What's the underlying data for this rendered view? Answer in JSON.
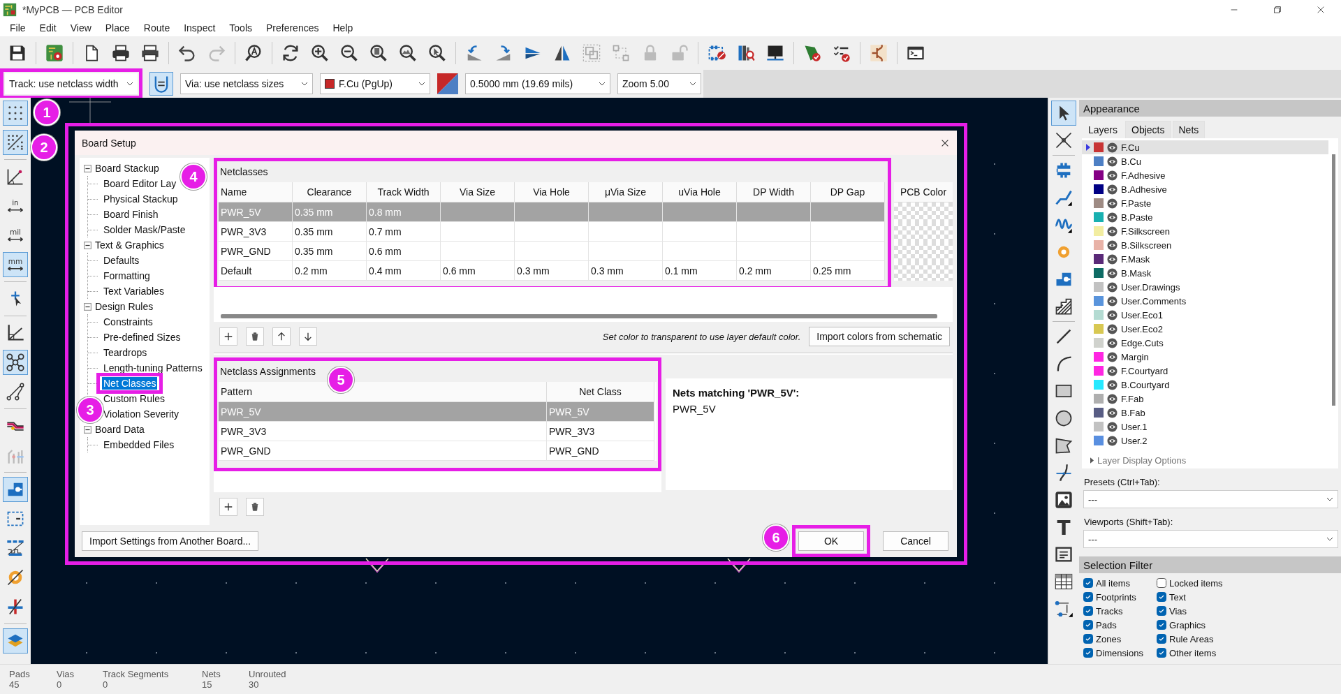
{
  "window": {
    "title": "*MyPCB — PCB Editor"
  },
  "menu": [
    "File",
    "Edit",
    "View",
    "Place",
    "Route",
    "Inspect",
    "Tools",
    "Preferences",
    "Help"
  ],
  "toolbar2": {
    "track": "Track: use netclass width",
    "width_toggle": {
      "selected": true
    },
    "via": "Via: use netclass sizes",
    "layer": "F.Cu (PgUp)",
    "grid": "0.5000 mm (19.69 mils)",
    "zoom": "Zoom 5.00"
  },
  "left_toolbar": [
    {
      "selected": true
    },
    {
      "selected": true
    },
    {
      "selected": false
    },
    {
      "label": "in",
      "selected": false
    },
    {
      "label": "mil",
      "selected": false
    },
    {
      "label": "mm",
      "selected": true
    },
    {
      "selected": false
    },
    {
      "selected": false
    },
    {
      "selected": true
    },
    {
      "selected": false
    },
    {
      "selected": false
    },
    {
      "selected": false
    },
    {
      "selected": true
    },
    {
      "selected": false
    },
    {
      "selected": false
    },
    {
      "selected": false
    },
    {
      "selected": false
    },
    {
      "selected": true
    }
  ],
  "dialog": {
    "title": "Board Setup",
    "tree": [
      {
        "label": "Board Stackup",
        "expanded": true,
        "selected": false,
        "children": [
          {
            "label": "Board Editor Lay",
            "selected": false
          },
          {
            "label": "Physical Stackup",
            "selected": false
          },
          {
            "label": "Board Finish",
            "selected": false
          },
          {
            "label": "Solder Mask/Paste",
            "selected": false
          }
        ]
      },
      {
        "label": "Text & Graphics",
        "expanded": true,
        "selected": false,
        "children": [
          {
            "label": "Defaults",
            "selected": false
          },
          {
            "label": "Formatting",
            "selected": false
          },
          {
            "label": "Text Variables",
            "selected": false
          }
        ]
      },
      {
        "label": "Design Rules",
        "expanded": true,
        "selected": false,
        "children": [
          {
            "label": "Constraints",
            "selected": false
          },
          {
            "label": "Pre-defined Sizes",
            "selected": false
          },
          {
            "label": "Teardrops",
            "selected": false
          },
          {
            "label": "Length-tuning Patterns",
            "selected": false
          },
          {
            "label": "Net Classes",
            "selected": true
          },
          {
            "label": "Custom Rules",
            "selected": false
          },
          {
            "label": "Violation Severity",
            "selected": false
          }
        ]
      },
      {
        "label": "Board Data",
        "expanded": true,
        "selected": false,
        "children": [
          {
            "label": "Embedded Files",
            "selected": false
          }
        ]
      }
    ],
    "netclasses": {
      "title": "Netclasses",
      "columns": [
        "Name",
        "Clearance",
        "Track Width",
        "Via Size",
        "Via Hole",
        "μVia Size",
        "uVia Hole",
        "DP Width",
        "DP Gap"
      ],
      "color_column": "PCB Color",
      "rows": [
        {
          "selected": true,
          "cells": [
            "PWR_5V",
            "0.35 mm",
            "0.8 mm",
            null,
            null,
            null,
            null,
            null,
            null
          ]
        },
        {
          "selected": false,
          "cells": [
            "PWR_3V3",
            "0.35 mm",
            "0.7 mm",
            null,
            null,
            null,
            null,
            null,
            null
          ]
        },
        {
          "selected": false,
          "cells": [
            "PWR_GND",
            "0.35 mm",
            "0.6 mm",
            null,
            null,
            null,
            null,
            null,
            null
          ]
        },
        {
          "selected": false,
          "cells": [
            "Default",
            "0.2 mm",
            "0.4 mm",
            "0.6 mm",
            "0.3 mm",
            "0.3 mm",
            "0.1 mm",
            "0.2 mm",
            "0.25 mm"
          ]
        }
      ]
    },
    "note": "Set color to transparent to use layer default color.",
    "import_colors_button": "Import colors from schematic",
    "assignments": {
      "title": "Netclass Assignments",
      "columns": [
        "Pattern",
        "Net Class"
      ],
      "rows": [
        {
          "pattern": "PWR_5V",
          "net_class": "PWR_5V",
          "selected": true
        },
        {
          "pattern": "PWR_3V3",
          "net_class": "PWR_3V3",
          "selected": false
        },
        {
          "pattern": "PWR_GND",
          "net_class": "PWR_GND",
          "selected": false
        }
      ]
    },
    "matches": {
      "title": "Nets matching 'PWR_5V':",
      "nets": [
        "PWR_5V"
      ]
    },
    "import_settings_button": "Import Settings from Another Board...",
    "ok_button": "OK",
    "cancel_button": "Cancel"
  },
  "right_toolbar": [
    {
      "selected": true
    },
    {
      "selected": false
    },
    {
      "selected": false
    },
    {
      "selected": false
    },
    {
      "selected": false
    },
    {
      "selected": false
    },
    {
      "selected": false
    },
    {
      "selected": false
    },
    {
      "selected": false
    },
    {
      "selected": false
    },
    {
      "selected": false
    },
    {
      "selected": false
    },
    {
      "selected": false
    },
    {
      "selected": false
    },
    {
      "selected": false
    },
    {
      "label": "T",
      "selected": false
    },
    {
      "selected": false
    },
    {
      "selected": false
    },
    {
      "selected": false
    }
  ],
  "appearance": {
    "title": "Appearance",
    "tabs": [
      {
        "label": "Layers",
        "selected": true
      },
      {
        "label": "Objects",
        "selected": false
      },
      {
        "label": "Nets",
        "selected": false
      }
    ],
    "layers": [
      {
        "name": "F.Cu",
        "color": "#c83434",
        "selected": true
      },
      {
        "name": "B.Cu",
        "color": "#4d7fc4",
        "selected": false
      },
      {
        "name": "F.Adhesive",
        "color": "#840084",
        "selected": false
      },
      {
        "name": "B.Adhesive",
        "color": "#000084",
        "selected": false
      },
      {
        "name": "F.Paste",
        "color": "#9e8b84",
        "selected": false
      },
      {
        "name": "B.Paste",
        "color": "#18b0b0",
        "selected": false
      },
      {
        "name": "F.Silkscreen",
        "color": "#f2eda1",
        "selected": false
      },
      {
        "name": "B.Silkscreen",
        "color": "#e8b2a7",
        "selected": false
      },
      {
        "name": "F.Mask",
        "color": "#5a2a78",
        "selected": false
      },
      {
        "name": "B.Mask",
        "color": "#0e6b64",
        "selected": false
      },
      {
        "name": "User.Drawings",
        "color": "#c2c2c2",
        "selected": false
      },
      {
        "name": "User.Comments",
        "color": "#5994dc",
        "selected": false
      },
      {
        "name": "User.Eco1",
        "color": "#b4dbd2",
        "selected": false
      },
      {
        "name": "User.Eco2",
        "color": "#d8c852",
        "selected": false
      },
      {
        "name": "Edge.Cuts",
        "color": "#d0d2cd",
        "selected": false
      },
      {
        "name": "Margin",
        "color": "#ff26e2",
        "selected": false
      },
      {
        "name": "F.Courtyard",
        "color": "#ff26e2",
        "selected": false
      },
      {
        "name": "B.Courtyard",
        "color": "#26e9ff",
        "selected": false
      },
      {
        "name": "F.Fab",
        "color": "#afafaf",
        "selected": false
      },
      {
        "name": "B.Fab",
        "color": "#585d84",
        "selected": false
      },
      {
        "name": "User.1",
        "color": "#c2c2c2",
        "selected": false
      },
      {
        "name": "User.2",
        "color": "#598fe0",
        "selected": false
      }
    ],
    "layer_display_options": "Layer Display Options",
    "presets": {
      "label": "Presets (Ctrl+Tab):",
      "value": "---"
    },
    "viewports": {
      "label": "Viewports (Shift+Tab):",
      "value": "---"
    }
  },
  "selection_filter": {
    "title": "Selection Filter",
    "items": [
      {
        "label": "All items",
        "checked": true
      },
      {
        "label": "Locked items",
        "checked": false
      },
      {
        "label": "Footprints",
        "checked": true
      },
      {
        "label": "Text",
        "checked": true
      },
      {
        "label": "Tracks",
        "checked": true
      },
      {
        "label": "Vias",
        "checked": true
      },
      {
        "label": "Pads",
        "checked": true
      },
      {
        "label": "Graphics",
        "checked": true
      },
      {
        "label": "Zones",
        "checked": true
      },
      {
        "label": "Rule Areas",
        "checked": true
      },
      {
        "label": "Dimensions",
        "checked": true
      },
      {
        "label": "Other items",
        "checked": true
      }
    ]
  },
  "status_bar": [
    {
      "label": "Pads",
      "value": "45"
    },
    {
      "label": "Vias",
      "value": "0"
    },
    {
      "label": "Track Segments",
      "value": "0"
    },
    {
      "label": "Nets",
      "value": "15"
    },
    {
      "label": "Unrouted",
      "value": "30"
    }
  ],
  "annotations": [
    {
      "label": "1"
    },
    {
      "label": "2"
    },
    {
      "label": "3"
    },
    {
      "label": "4"
    },
    {
      "label": "5"
    },
    {
      "label": "6"
    }
  ]
}
